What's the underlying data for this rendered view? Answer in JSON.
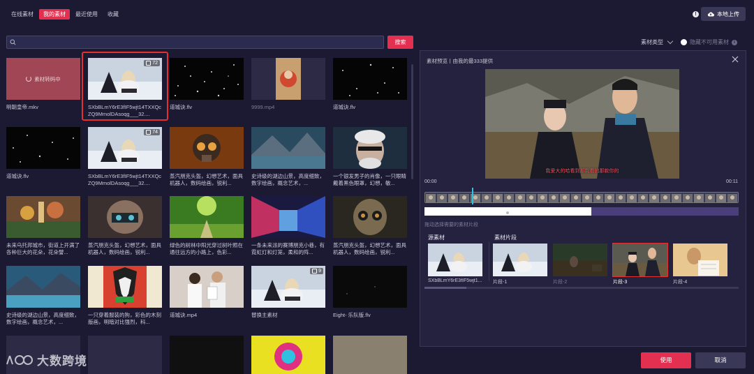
{
  "tabs": [
    {
      "label": "在线素材",
      "active": false
    },
    {
      "label": "我的素材",
      "active": true
    },
    {
      "label": "最近使用",
      "active": false
    },
    {
      "label": "收藏",
      "active": false
    }
  ],
  "header": {
    "help_icon": "!",
    "upload_label": "本地上传",
    "upload_icon": "cloud-upload-icon"
  },
  "search": {
    "placeholder": "",
    "button_label": "搜索"
  },
  "filters": {
    "type_label": "素材类型",
    "hide_label": "隐藏不可用素材",
    "info": "i"
  },
  "grid": {
    "transcoding_label": "素材转码中",
    "items": [
      {
        "caption": "明朝皇帝.mkv",
        "badge": ""
      },
      {
        "caption": "SXbBLmY6rE3fIF5wjt14TXXQcZQ9MmolDAsoqg___32....",
        "badge": "72"
      },
      {
        "caption": "道城诀.flv",
        "badge": ""
      },
      {
        "caption": "9999.mp4",
        "badge": ""
      },
      {
        "caption": "道城诀.flv",
        "badge": ""
      },
      {
        "caption": "道城诀.flv",
        "badge": ""
      },
      {
        "caption": "SXbBLmY6rE3fIF5wjt14TXXQcZQ9MmolDAsoqg___32....",
        "badge": "74"
      },
      {
        "caption": "蒸汽朋克头盔，幻想艺术，面具机器人，数码绘画，锐利...",
        "badge": ""
      },
      {
        "caption": "史诗级的湖边山景，高度细致，数字绘画，概念艺术，...",
        "badge": ""
      },
      {
        "caption": "一个银发男子的肖像，一只眼睛戴着黑色眼罩，幻想，敏...",
        "badge": ""
      },
      {
        "caption": "未来乌托邦城市，街道上开满了各种巨大的花朵，花朵譬...",
        "badge": ""
      },
      {
        "caption": "蒸汽朋克头盔，幻想艺术，面具机器人，数码绘画，锐利...",
        "badge": ""
      },
      {
        "caption": "绿色的树林中阳光穿过树叶照在通往远方的小路上，色彩...",
        "badge": ""
      },
      {
        "caption": "一条未来派的赛博朋克小巷，有霓虹灯和灯笼，柔和的阵...",
        "badge": ""
      },
      {
        "caption": "蒸汽朋克头盔，幻想艺术，面具机器人，数码绘画，锐利...",
        "badge": ""
      },
      {
        "caption": "史诗级的湖边山景，高度细致，数字绘画，概念艺术，...",
        "badge": ""
      },
      {
        "caption": "一只穿着服装的狗，彩色的木刻版画，明暗对比强烈，科...",
        "badge": ""
      },
      {
        "caption": "道城诀.mp4",
        "badge": ""
      },
      {
        "caption": "替换主素材",
        "badge": "9"
      },
      {
        "caption": "Eight- 乐队版.flv",
        "badge": ""
      }
    ]
  },
  "preview": {
    "title": "素材预览丨由我的最333提供",
    "subtitle": "我爱大的哈看到那我看的那款你的",
    "time_start": "00:00",
    "time_end": "00:11",
    "progress": 0.53,
    "playhead": 0.15,
    "hint": "拖动选择需要的素材片段",
    "source_label": "源素材",
    "clips_label": "素材片段",
    "source_caption": "SXbBLmY6rE3fIF5wjt1...",
    "clips": [
      {
        "label": "片段-1",
        "state": "normal"
      },
      {
        "label": "片段-2",
        "state": "dim"
      },
      {
        "label": "片段-3",
        "state": "active"
      },
      {
        "label": "片段-4",
        "state": "normal"
      }
    ]
  },
  "footer": {
    "use_label": "使用",
    "cancel_label": "取消"
  },
  "watermark": {
    "text": "大数跨境"
  },
  "colors": {
    "accent": "#e43050",
    "background": "#1c1a33",
    "panel": "#24223f",
    "playhead": "#29c6e0"
  }
}
